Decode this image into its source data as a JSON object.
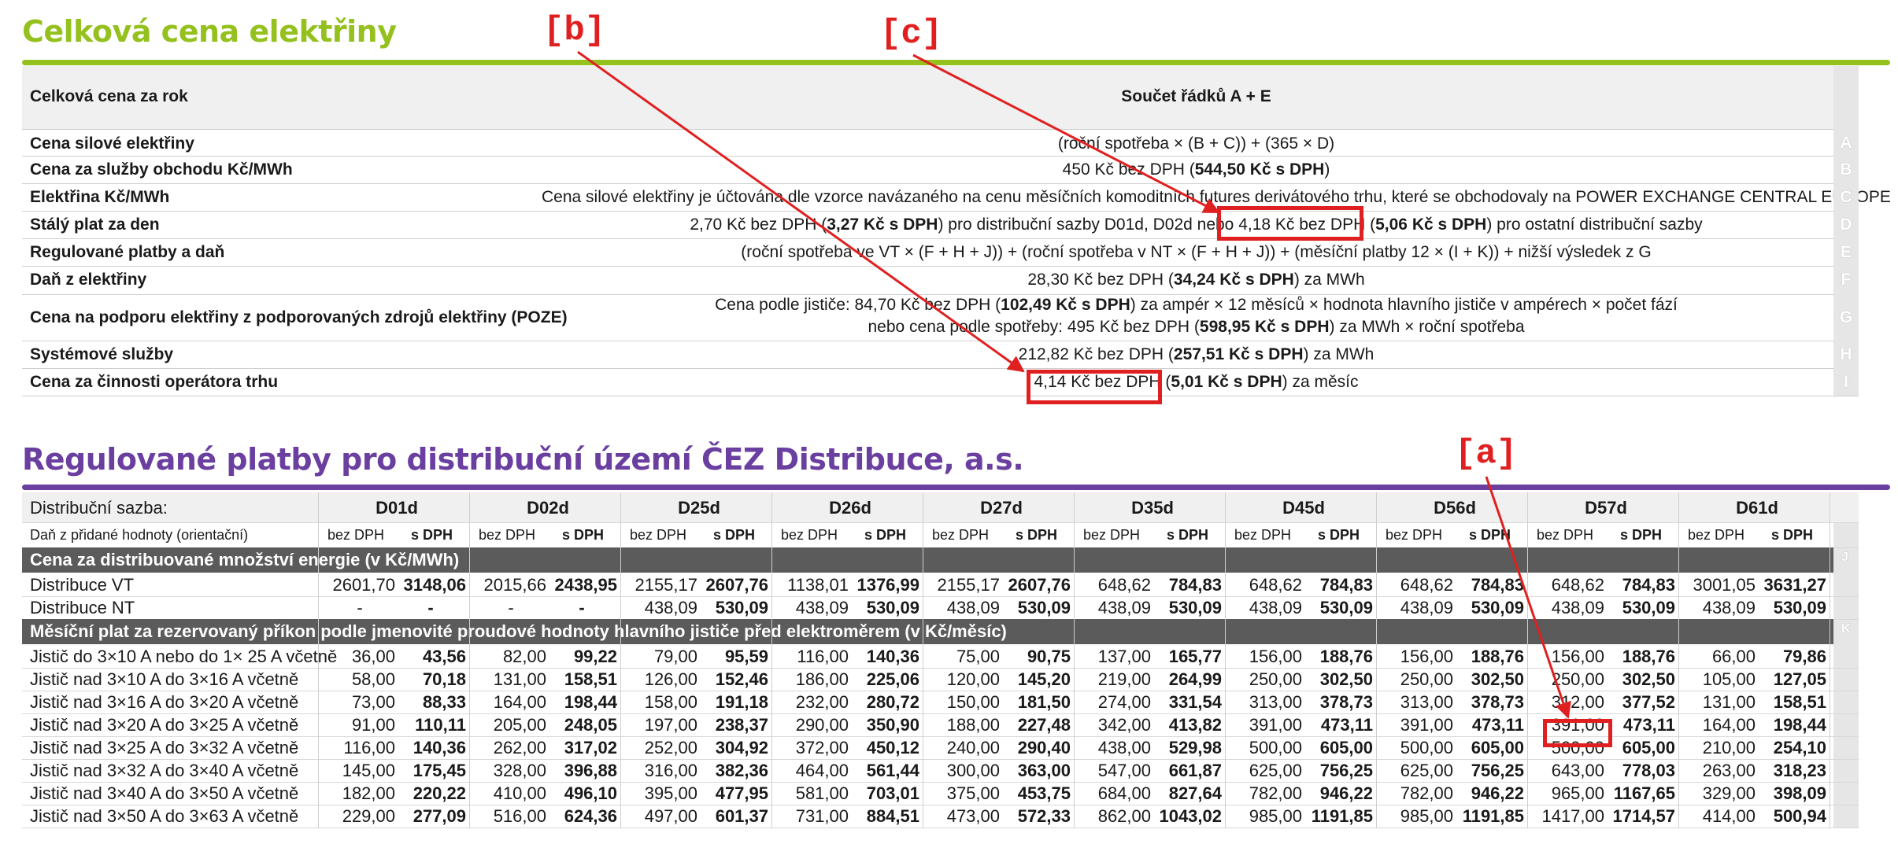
{
  "section1": {
    "title": "Celková cena elektřiny",
    "header": {
      "label": "Celková cena za rok",
      "value": "Součet řádků A + E"
    },
    "rows": [
      {
        "letter": "A",
        "label": "Cena silové elektřiny",
        "value_parts": [
          {
            "t": "(roční spotřeba × (B + C)) + (365 × D)",
            "b": false
          }
        ]
      },
      {
        "letter": "B",
        "label": "Cena za služby obchodu Kč/MWh",
        "value_parts": [
          {
            "t": "450 Kč bez DPH (",
            "b": false
          },
          {
            "t": "544,50 Kč s DPH",
            "b": true
          },
          {
            "t": ")",
            "b": false
          }
        ]
      },
      {
        "letter": "C",
        "label": "Elektřina Kč/MWh",
        "value_parts": [
          {
            "t": "Cena silové elektřiny je účtována dle vzorce navázaného na cenu měsíčních komoditních futures derivátového trhu, které se obchodovaly na POWER EXCHANGE CENTRAL EUROPE",
            "b": false
          }
        ]
      },
      {
        "letter": "D",
        "label": "Stálý plat za den",
        "value_parts": [
          {
            "t": "2,70 Kč bez DPH (",
            "b": false
          },
          {
            "t": "3,27 Kč s DPH",
            "b": true
          },
          {
            "t": ") pro distribuční sazby D01d, D02d nebo 4,18 Kč bez DPH (",
            "b": false
          },
          {
            "t": "5,06 Kč s DPH",
            "b": true
          },
          {
            "t": ") pro ostatní distribuční sazby",
            "b": false
          }
        ]
      },
      {
        "letter": "E",
        "label": "Regulované platby a daň",
        "value_parts": [
          {
            "t": "(roční spotřeba ve VT × (F + H + J)) + (roční spotřeba v NT × (F + H + J)) + (měsíční platby 12 × (I + K)) + nižší výsledek z G",
            "b": false
          }
        ]
      },
      {
        "letter": "F",
        "label": "Daň z elektřiny",
        "value_parts": [
          {
            "t": "28,30 Kč bez DPH (",
            "b": false
          },
          {
            "t": "34,24 Kč s DPH",
            "b": true
          },
          {
            "t": ") za MWh",
            "b": false
          }
        ]
      },
      {
        "letter": "G",
        "label": "Cena na podporu elektřiny z podporovaných zdrojů elektřiny (POZE)",
        "value_parts": [
          {
            "t": "Cena podle jističe: 84,70 Kč bez DPH (",
            "b": false
          },
          {
            "t": "102,49 Kč s DPH",
            "b": true
          },
          {
            "t": ") za ampér × 12 měsíců × hodnota hlavního jističe v ampérech × počet fází",
            "b": false
          }
        ],
        "value_parts2": [
          {
            "t": "nebo cena podle spotřeby: 495 Kč bez DPH (",
            "b": false
          },
          {
            "t": "598,95 Kč s DPH",
            "b": true
          },
          {
            "t": ") za MWh × roční spotřeba",
            "b": false
          }
        ]
      },
      {
        "letter": "H",
        "label": "Systémové služby",
        "value_parts": [
          {
            "t": "212,82 Kč bez DPH (",
            "b": false
          },
          {
            "t": "257,51 Kč s DPH",
            "b": true
          },
          {
            "t": ") za MWh",
            "b": false
          }
        ]
      },
      {
        "letter": "I",
        "label": "Cena za činnosti operátora trhu",
        "value_parts": [
          {
            "t": "4,14 Kč bez DPH (",
            "b": false
          },
          {
            "t": "5,01 Kč s DPH",
            "b": true
          },
          {
            "t": ") za měsíc",
            "b": false
          }
        ]
      }
    ]
  },
  "section2": {
    "title": "Regulované platby pro distribuční území ČEZ Distribuce, a.s.",
    "sazba_label": "Distribuční sazba:",
    "dph_label": "Daň z přidané hodnoty (orientační)",
    "bez": "bez DPH",
    "s": "s DPH",
    "rates": [
      "D01d",
      "D02d",
      "D25d",
      "D26d",
      "D27d",
      "D35d",
      "D45d",
      "D56d",
      "D57d",
      "D61d"
    ],
    "band_j": {
      "letter": "J",
      "label": "Cena za distribuované množství energie (v Kč/MWh)"
    },
    "rows_j": [
      {
        "label": "Distribuce VT",
        "values": [
          "2601,70",
          "3148,06",
          "2015,66",
          "2438,95",
          "2155,17",
          "2607,76",
          "1138,01",
          "1376,99",
          "2155,17",
          "2607,76",
          "648,62",
          "784,83",
          "648,62",
          "784,83",
          "648,62",
          "784,83",
          "648,62",
          "784,83",
          "3001,05",
          "3631,27"
        ]
      },
      {
        "label": "Distribuce NT",
        "values": [
          "-",
          "-",
          "-",
          "-",
          "438,09",
          "530,09",
          "438,09",
          "530,09",
          "438,09",
          "530,09",
          "438,09",
          "530,09",
          "438,09",
          "530,09",
          "438,09",
          "530,09",
          "438,09",
          "530,09",
          "438,09",
          "530,09"
        ]
      }
    ],
    "band_k": {
      "letter": "K",
      "label": "Měsíční plat za rezervovaný příkon podle jmenovité proudové hodnoty hlavního jističe před elektroměrem (v Kč/měsíc)"
    },
    "rows_k": [
      {
        "label": "Jistič do 3×10 A nebo do 1× 25 A včetně",
        "values": [
          "36,00",
          "43,56",
          "82,00",
          "99,22",
          "79,00",
          "95,59",
          "116,00",
          "140,36",
          "75,00",
          "90,75",
          "137,00",
          "165,77",
          "156,00",
          "188,76",
          "156,00",
          "188,76",
          "156,00",
          "188,76",
          "66,00",
          "79,86"
        ]
      },
      {
        "label": "Jistič nad 3×10 A do 3×16 A včetně",
        "values": [
          "58,00",
          "70,18",
          "131,00",
          "158,51",
          "126,00",
          "152,46",
          "186,00",
          "225,06",
          "120,00",
          "145,20",
          "219,00",
          "264,99",
          "250,00",
          "302,50",
          "250,00",
          "302,50",
          "250,00",
          "302,50",
          "105,00",
          "127,05"
        ]
      },
      {
        "label": "Jistič nad 3×16 A do 3×20 A včetně",
        "values": [
          "73,00",
          "88,33",
          "164,00",
          "198,44",
          "158,00",
          "191,18",
          "232,00",
          "280,72",
          "150,00",
          "181,50",
          "274,00",
          "331,54",
          "313,00",
          "378,73",
          "313,00",
          "378,73",
          "312,00",
          "377,52",
          "131,00",
          "158,51"
        ]
      },
      {
        "label": "Jistič nad 3×20 A do 3×25 A včetně",
        "values": [
          "91,00",
          "110,11",
          "205,00",
          "248,05",
          "197,00",
          "238,37",
          "290,00",
          "350,90",
          "188,00",
          "227,48",
          "342,00",
          "413,82",
          "391,00",
          "473,11",
          "391,00",
          "473,11",
          "391,00",
          "473,11",
          "164,00",
          "198,44"
        ]
      },
      {
        "label": "Jistič nad 3×25 A do 3×32 A včetně",
        "values": [
          "116,00",
          "140,36",
          "262,00",
          "317,02",
          "252,00",
          "304,92",
          "372,00",
          "450,12",
          "240,00",
          "290,40",
          "438,00",
          "529,98",
          "500,00",
          "605,00",
          "500,00",
          "605,00",
          "500,00",
          "605,00",
          "210,00",
          "254,10"
        ]
      },
      {
        "label": "Jistič nad 3×32 A do 3×40 A včetně",
        "values": [
          "145,00",
          "175,45",
          "328,00",
          "396,88",
          "316,00",
          "382,36",
          "464,00",
          "561,44",
          "300,00",
          "363,00",
          "547,00",
          "661,87",
          "625,00",
          "756,25",
          "625,00",
          "756,25",
          "643,00",
          "778,03",
          "263,00",
          "318,23"
        ]
      },
      {
        "label": "Jistič nad 3×40 A do 3×50 A včetně",
        "values": [
          "182,00",
          "220,22",
          "410,00",
          "496,10",
          "395,00",
          "477,95",
          "581,00",
          "703,01",
          "375,00",
          "453,75",
          "684,00",
          "827,64",
          "782,00",
          "946,22",
          "782,00",
          "946,22",
          "965,00",
          "1167,65",
          "329,00",
          "398,09"
        ]
      },
      {
        "label": "Jistič nad 3×50 A do 3×63 A včetně",
        "values": [
          "229,00",
          "277,09",
          "516,00",
          "624,36",
          "497,00",
          "601,37",
          "731,00",
          "884,51",
          "473,00",
          "572,33",
          "862,00",
          "1043,02",
          "985,00",
          "1191,85",
          "985,00",
          "1191,85",
          "1417,00",
          "1714,57",
          "414,00",
          "500,94"
        ]
      }
    ]
  },
  "annotations": {
    "a": "[a]",
    "b": "[b]",
    "c": "[c]"
  },
  "colors": {
    "green": "#95c11f",
    "purple": "#6b3fa0",
    "band": "#5b5b5b",
    "red": "#e02020"
  }
}
